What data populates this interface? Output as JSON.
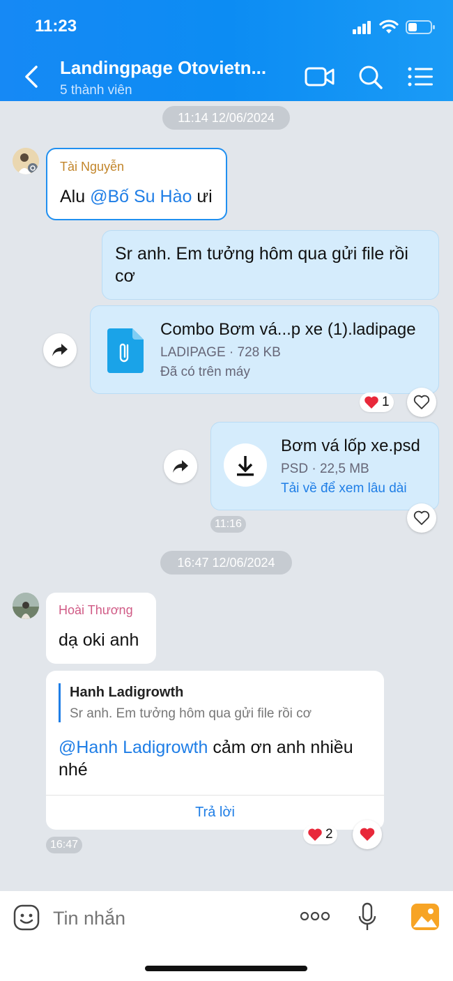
{
  "status": {
    "time": "11:23"
  },
  "header": {
    "title": "Landingpage Otovietn...",
    "subtitle": "5 thành viên"
  },
  "dates": {
    "first": "11:14 12/06/2024",
    "second": "16:47 12/06/2024"
  },
  "messages": {
    "m1": {
      "sender": "Tài Nguyễn",
      "text_prefix": "Alu ",
      "mention": "@Bố Su Hào",
      "text_suffix": " ưi"
    },
    "m2": {
      "text": "Sr anh. Em tưởng hôm qua gửi file rồi cơ"
    },
    "file1": {
      "name": "Combo Bơm vá...p xe (1).ladipage",
      "meta": "LADIPAGE · 728 KB",
      "status": "Đã có trên máy",
      "reaction_count": "1"
    },
    "file2": {
      "name": "Bơm vá lốp xe.psd",
      "meta": "PSD · 22,5 MB",
      "status": "Tải về để xem lâu dài",
      "time": "11:16"
    },
    "m3": {
      "sender": "Hoài Thương",
      "text": "dạ oki anh"
    },
    "m4": {
      "quote_author": "Hanh Ladigrowth",
      "quote_text": "Sr anh. Em tưởng hôm qua gửi file rồi cơ",
      "mention": "@Hanh Ladigrowth",
      "text": " cảm ơn anh nhiều nhé",
      "reply_label": "Trả lời",
      "reaction_count": "2",
      "time": "16:47"
    }
  },
  "composer": {
    "placeholder": "Tin nhắn"
  },
  "colors": {
    "header": "#1689f5",
    "mention": "#1f7ee6",
    "heart": "#e8283a",
    "file_icon": "#1aa3e8"
  }
}
